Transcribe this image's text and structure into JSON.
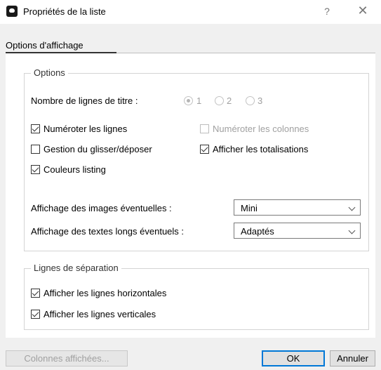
{
  "window": {
    "title": "Propriétés de la liste",
    "help_label": "?",
    "close_label": "✕"
  },
  "tabs": [
    {
      "label": "Options d'affichage",
      "selected": true
    }
  ],
  "options_group": {
    "legend": "Options",
    "title_rows": {
      "label": "Nombre de lignes de titre :",
      "choices": [
        {
          "label": "1",
          "checked": true
        },
        {
          "label": "2",
          "checked": false
        },
        {
          "label": "3",
          "checked": false
        }
      ],
      "disabled": true
    },
    "checkboxes": {
      "number_rows": {
        "label": "Numéroter les lignes",
        "checked": true
      },
      "number_columns": {
        "label": "Numéroter les colonnes",
        "checked": false,
        "disabled": true
      },
      "drag_drop": {
        "label": "Gestion du glisser/déposer",
        "checked": false
      },
      "show_totals": {
        "label": "Afficher les totalisations",
        "checked": true
      },
      "listing_colors": {
        "label": "Couleurs listing",
        "checked": true
      }
    },
    "images_display": {
      "label": "Affichage des images éventuelles :",
      "value": "Mini"
    },
    "long_texts_display": {
      "label": "Affichage des textes longs éventuels :",
      "value": "Adaptés"
    }
  },
  "separation_group": {
    "legend": "Lignes de séparation",
    "horizontal": {
      "label": "Afficher les lignes horizontales",
      "checked": true
    },
    "vertical": {
      "label": "Afficher les lignes verticales",
      "checked": true
    }
  },
  "footer": {
    "columns_button": "Colonnes affichées...",
    "ok_button": "OK",
    "cancel_button": "Annuler"
  }
}
